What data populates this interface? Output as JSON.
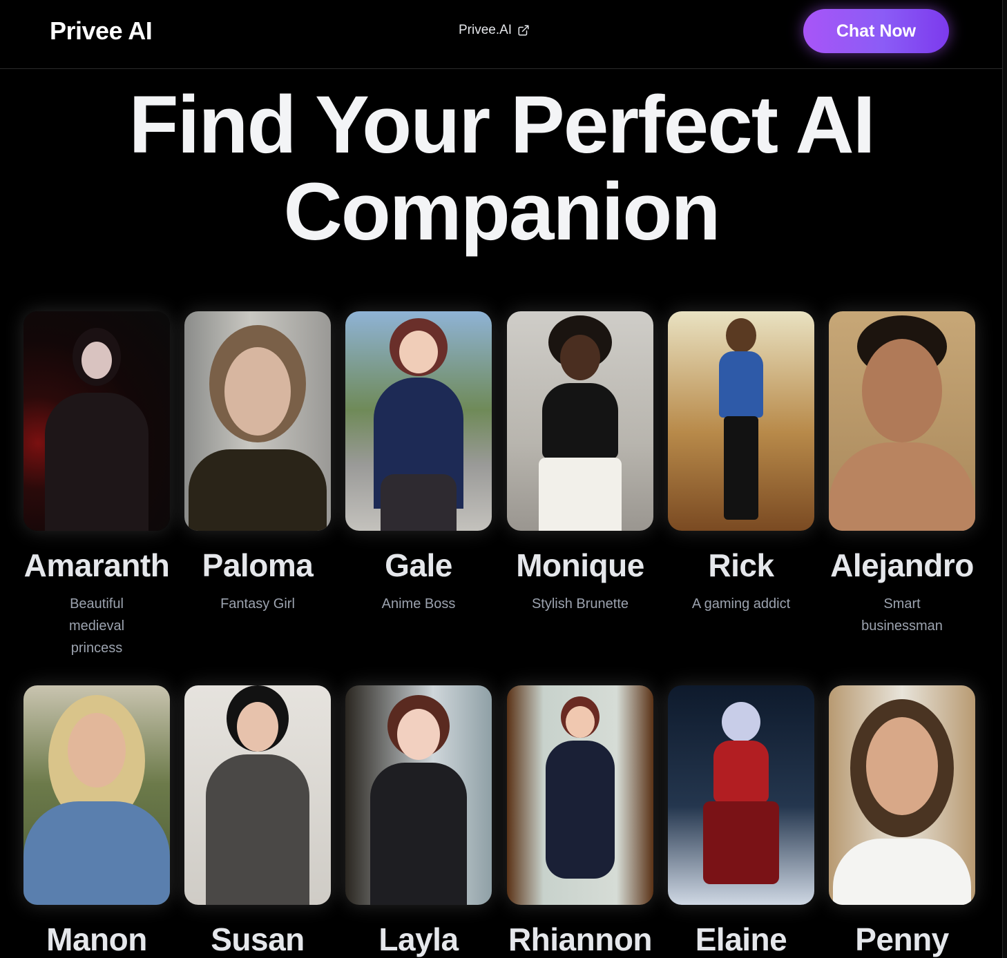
{
  "header": {
    "brand": "Privee AI",
    "link_label": "Privee.AI",
    "link_icon": "external-link-icon",
    "cta_label": "Chat Now",
    "cta_color": "#a855f7"
  },
  "hero": {
    "title": "Find Your Perfect AI Companion"
  },
  "companions": [
    {
      "name": "Amaranth",
      "description": "Beautiful medieval princess"
    },
    {
      "name": "Paloma",
      "description": "Fantasy Girl"
    },
    {
      "name": "Gale",
      "description": "Anime Boss"
    },
    {
      "name": "Monique",
      "description": "Stylish Brunette"
    },
    {
      "name": "Rick",
      "description": "A gaming addict"
    },
    {
      "name": "Alejandro",
      "description": "Smart businessman"
    },
    {
      "name": "Manon",
      "description": ""
    },
    {
      "name": "Susan",
      "description": ""
    },
    {
      "name": "Layla",
      "description": ""
    },
    {
      "name": "Rhiannon",
      "description": ""
    },
    {
      "name": "Elaine",
      "description": ""
    },
    {
      "name": "Penny",
      "description": ""
    }
  ]
}
